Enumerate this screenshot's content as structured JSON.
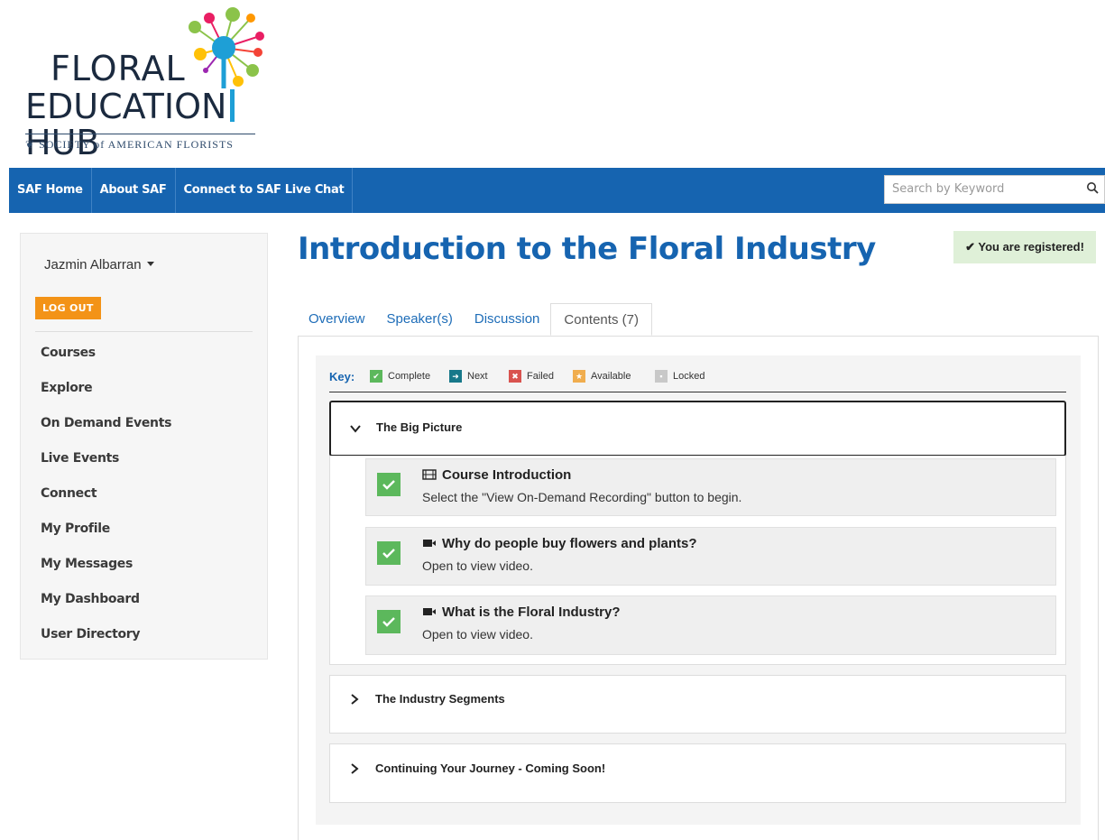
{
  "logo": {
    "line1": "FLORAL",
    "line2a": "EDUCATION",
    "line2b": "HUB",
    "tagline": "SOCIETY of AMERICAN FLORISTS"
  },
  "nav": {
    "links": [
      "SAF Home",
      "About SAF",
      "Connect to SAF Live Chat"
    ],
    "search_placeholder": "Search by Keyword"
  },
  "sidebar": {
    "user_name": "Jazmin Albarran",
    "logout_label": "LOG OUT",
    "items": [
      "Courses",
      "Explore",
      "On Demand Events",
      "Live Events",
      "Connect",
      "My Profile",
      "My Messages",
      "My Dashboard",
      "User Directory"
    ]
  },
  "main": {
    "title": "Introduction to the Floral Industry",
    "registered": "You are registered!",
    "tabs": [
      "Overview",
      "Speaker(s)",
      "Discussion",
      "Contents (7)"
    ],
    "key": {
      "label": "Key:",
      "items": [
        "Complete",
        "Next",
        "Failed",
        "Available",
        "Locked"
      ]
    },
    "sections": [
      {
        "title": "The Big Picture",
        "items": [
          {
            "title": "Course Introduction",
            "desc": "Select the \"View On-Demand Recording\" button to begin."
          },
          {
            "title": "Why do people buy flowers and plants?",
            "desc": "Open to view video."
          },
          {
            "title": "What is the Floral Industry?",
            "desc": "Open to view video."
          }
        ]
      },
      {
        "title": "The Industry Segments"
      },
      {
        "title": "Continuing Your Journey - Coming Soon!"
      }
    ]
  },
  "colors": {
    "brand_blue": "#1664b0",
    "complete_green": "#5cb85c",
    "next_teal": "#17788a",
    "failed_red": "#d9534f",
    "available_orange": "#f0ad4e",
    "locked_gray": "#c8c8c8",
    "logout_orange": "#f39317"
  }
}
